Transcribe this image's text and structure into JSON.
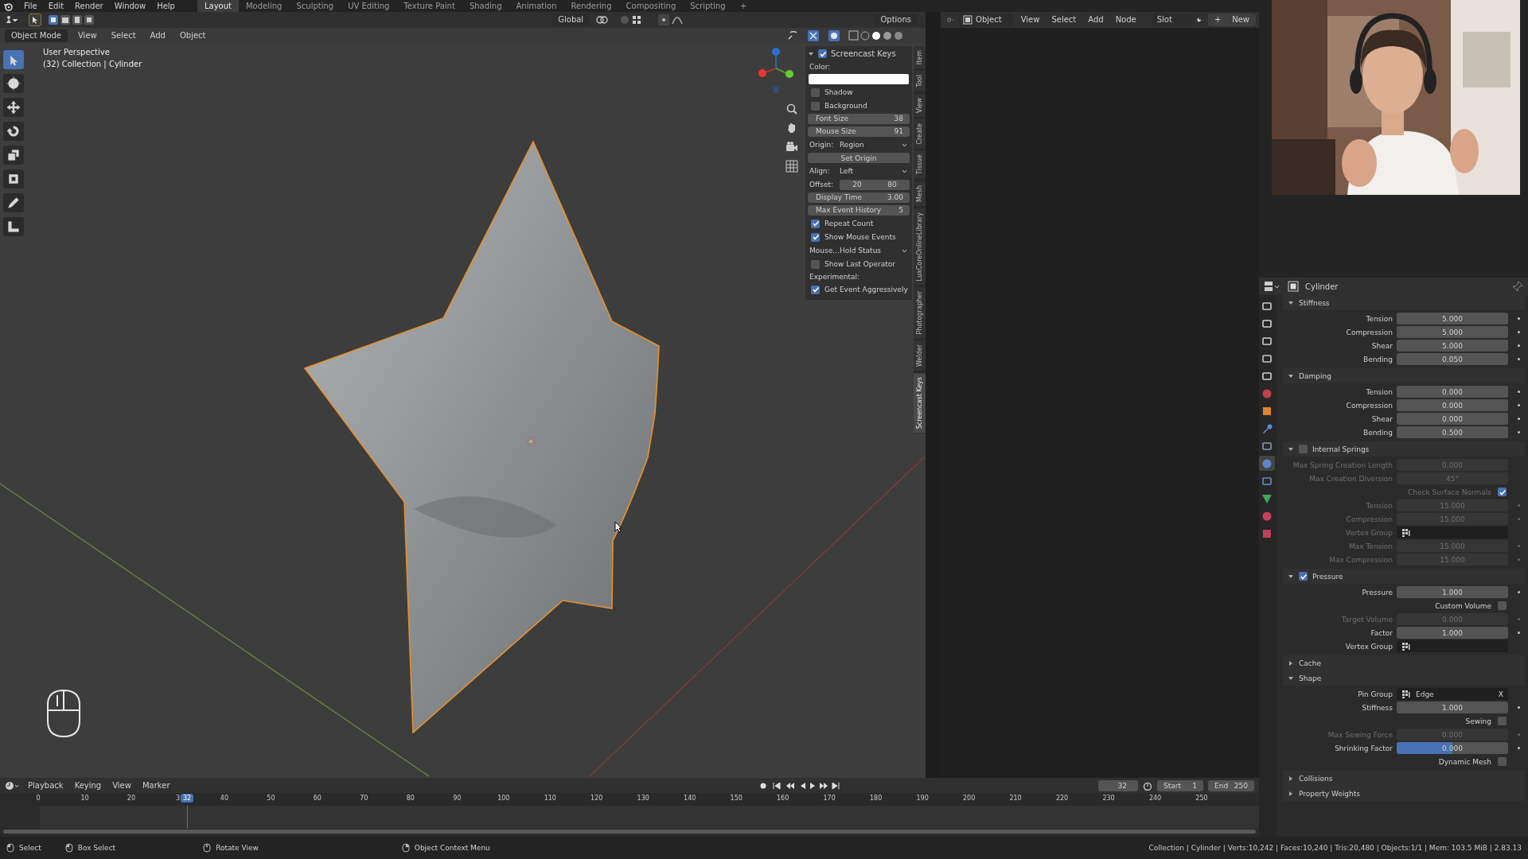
{
  "top_bar": {
    "menus": [
      "File",
      "Edit",
      "Render",
      "Window",
      "Help"
    ],
    "workspaces": [
      {
        "label": "Layout",
        "selected": true
      },
      {
        "label": "Modeling",
        "selected": false
      },
      {
        "label": "Sculpting",
        "selected": false
      },
      {
        "label": "UV Editing",
        "selected": false
      },
      {
        "label": "Texture Paint",
        "selected": false
      },
      {
        "label": "Shading",
        "selected": false
      },
      {
        "label": "Animation",
        "selected": false
      },
      {
        "label": "Rendering",
        "selected": false
      },
      {
        "label": "Compositing",
        "selected": false
      },
      {
        "label": "Scripting",
        "selected": false
      }
    ],
    "add_tab": "+"
  },
  "viewport": {
    "orientation": "Global",
    "options": "Options",
    "mode": "Object Mode",
    "menus": [
      "View",
      "Select",
      "Add",
      "Object"
    ],
    "overlay_lines": [
      "User Perspective",
      "(32) Collection | Cylinder"
    ],
    "tools": [
      {
        "kind": "select",
        "selected": true
      },
      {
        "kind": "cursor",
        "selected": false
      },
      {
        "kind": "move",
        "selected": false
      },
      {
        "kind": "rotate",
        "selected": false
      },
      {
        "kind": "scale",
        "selected": false
      },
      {
        "kind": "transform",
        "selected": false
      },
      {
        "kind": "annotate",
        "selected": false
      },
      {
        "kind": "measure",
        "selected": false
      }
    ],
    "side_tabs": [
      {
        "label": "Item",
        "selected": false
      },
      {
        "label": "Tool",
        "selected": false
      },
      {
        "label": "View",
        "selected": false
      },
      {
        "label": "Create",
        "selected": false
      },
      {
        "label": "Tissue",
        "selected": false
      },
      {
        "label": "Mesh",
        "selected": false
      },
      {
        "label": "LuxCoreOnlineLibrary",
        "selected": false
      },
      {
        "label": "Photographer",
        "selected": false
      },
      {
        "label": "Welder",
        "selected": false
      },
      {
        "label": "Screencast Keys",
        "selected": true
      }
    ],
    "n_panel": {
      "title": "Screencast Keys",
      "enabled": true,
      "items": [
        {
          "kind": "label",
          "label": "Color:"
        },
        {
          "kind": "color",
          "color": "#ffffff"
        },
        {
          "kind": "check",
          "label": "Shadow",
          "checked": false
        },
        {
          "kind": "check",
          "label": "Background",
          "checked": false
        },
        {
          "kind": "number",
          "label": "Font Size",
          "value": "38"
        },
        {
          "kind": "number",
          "label": "Mouse Size",
          "value": "91"
        },
        {
          "kind": "dropdown",
          "label": "Origin:",
          "value": "Region"
        },
        {
          "kind": "button",
          "label": "Set Origin"
        },
        {
          "kind": "dropdown",
          "label": "Align:",
          "value": "Left"
        },
        {
          "kind": "pair",
          "label": "Offset:",
          "values": [
            "20",
            "80"
          ]
        },
        {
          "kind": "number",
          "label": "Display Time",
          "value": "3.00"
        },
        {
          "kind": "number",
          "label": "Max Event History",
          "value": "5"
        },
        {
          "kind": "check",
          "label": "Repeat Count",
          "checked": true
        },
        {
          "kind": "check",
          "label": "Show Mouse Events",
          "checked": true
        },
        {
          "kind": "dropdown",
          "label": "Mouse...",
          "value": "Hold Status"
        },
        {
          "kind": "check",
          "label": "Show Last Operator",
          "checked": false
        },
        {
          "kind": "label",
          "label": "Experimental:"
        },
        {
          "kind": "check",
          "label": "Get Event Aggressively",
          "checked": true
        }
      ]
    }
  },
  "node_editor": {
    "type": "Object",
    "menus": [
      "View",
      "Select",
      "Add",
      "Node"
    ],
    "slot": "Slot",
    "new_button": "New",
    "add_icon": "+"
  },
  "properties": {
    "object": "Cylinder",
    "tabs": [
      {
        "kind": "tool",
        "selected": false
      },
      {
        "kind": "render",
        "selected": false
      },
      {
        "kind": "output",
        "selected": false
      },
      {
        "kind": "view-layer",
        "selected": false
      },
      {
        "kind": "scene",
        "selected": false
      },
      {
        "kind": "world",
        "selected": false
      },
      {
        "kind": "object",
        "selected": false
      },
      {
        "kind": "modifier",
        "selected": false
      },
      {
        "kind": "particles",
        "selected": false
      },
      {
        "kind": "physics",
        "selected": true
      },
      {
        "kind": "constraints",
        "selected": false
      },
      {
        "kind": "data",
        "selected": false
      },
      {
        "kind": "material",
        "selected": false
      },
      {
        "kind": "texture",
        "selected": false
      }
    ],
    "sections": [
      {
        "title": "Stiffness",
        "expanded": true,
        "rows": [
          {
            "kind": "number",
            "label": "Tension",
            "value": "5.000",
            "disabled": false,
            "dot": true
          },
          {
            "kind": "number",
            "label": "Compression",
            "value": "5.000",
            "disabled": false,
            "dot": true
          },
          {
            "kind": "number",
            "label": "Shear",
            "value": "5.000",
            "disabled": false,
            "dot": true
          },
          {
            "kind": "number",
            "label": "Bending",
            "value": "0.050",
            "disabled": false,
            "dot": true
          }
        ]
      },
      {
        "title": "Damping",
        "expanded": true,
        "rows": [
          {
            "kind": "number",
            "label": "Tension",
            "value": "0.000",
            "disabled": false,
            "dot": true
          },
          {
            "kind": "number",
            "label": "Compression",
            "value": "0.000",
            "disabled": false,
            "dot": true
          },
          {
            "kind": "number",
            "label": "Shear",
            "value": "0.000",
            "disabled": false,
            "dot": true
          },
          {
            "kind": "number",
            "label": "Bending",
            "value": "0.500",
            "disabled": false,
            "dot": true
          }
        ]
      },
      {
        "title": "Internal Springs",
        "expanded": true,
        "checked": false,
        "rows": [
          {
            "kind": "number",
            "label": "Max Spring Creation Length",
            "value": "0.000",
            "disabled": true,
            "dot": false
          },
          {
            "kind": "number",
            "label": "Max Creation Diversion",
            "value": "45°",
            "disabled": true,
            "dot": false
          },
          {
            "kind": "check",
            "label": "Check Surface Normals",
            "checked": true,
            "disabled": true
          },
          {
            "kind": "number",
            "label": "Tension",
            "value": "15.000",
            "disabled": true,
            "dot": true
          },
          {
            "kind": "number",
            "label": "Compression",
            "value": "15.000",
            "disabled": true,
            "dot": true
          },
          {
            "kind": "group",
            "label": "Vertex Group",
            "disabled": true
          },
          {
            "kind": "number",
            "label": "Max Tension",
            "value": "15.000",
            "disabled": true,
            "dot": true
          },
          {
            "kind": "number",
            "label": "Max Compression",
            "value": "15.000",
            "disabled": true,
            "dot": true
          }
        ]
      },
      {
        "title": "Pressure",
        "expanded": true,
        "checked": true,
        "rows": [
          {
            "kind": "number",
            "label": "Pressure",
            "value": "1.000",
            "disabled": false,
            "dot": true
          },
          {
            "kind": "check",
            "label": "Custom Volume",
            "checked": false,
            "disabled": false
          },
          {
            "kind": "number",
            "label": "Target Volume",
            "value": "0.000",
            "disabled": true,
            "dot": true
          },
          {
            "kind": "number",
            "label": "Factor",
            "value": "1.000",
            "disabled": false,
            "dot": true
          },
          {
            "kind": "group",
            "label": "Vertex Group",
            "disabled": false
          }
        ]
      },
      {
        "title": "Cache",
        "expanded": false
      },
      {
        "title": "Shape",
        "expanded": true,
        "rows": [
          {
            "kind": "group",
            "label": "Pin Group",
            "value": "Edge",
            "clear": "X",
            "disabled": false
          },
          {
            "kind": "number",
            "label": "Stiffness",
            "value": "1.000",
            "disabled": false,
            "dot": true
          },
          {
            "kind": "check",
            "label": "Sewing",
            "checked": false,
            "disabled": false
          },
          {
            "kind": "number",
            "label": "Max Sewing Force",
            "value": "0.000",
            "disabled": true,
            "dot": true
          },
          {
            "kind": "number",
            "label": "Shrinking Factor",
            "value": "0.000",
            "disabled": false,
            "dot": true,
            "level": 0.5
          },
          {
            "kind": "check",
            "label": "Dynamic Mesh",
            "checked": false,
            "disabled": false
          }
        ]
      },
      {
        "title": "Collisions",
        "expanded": false
      },
      {
        "title": "Property Weights",
        "expanded": false
      }
    ]
  },
  "timeline": {
    "menus": [
      "Playback",
      "Keying",
      "View",
      "Marker"
    ],
    "current_frame": "32",
    "start_label": "Start",
    "start": "1",
    "end_label": "End",
    "end": "250",
    "ticks": [
      "0",
      "10",
      "20",
      "3",
      "40",
      "50",
      "60",
      "70",
      "80",
      "90",
      "100",
      "110",
      "120",
      "130",
      "140",
      "150",
      "160",
      "170",
      "180",
      "190",
      "200",
      "210",
      "220",
      "230",
      "240",
      "250"
    ],
    "playhead": {
      "label": "32",
      "level": 0.128
    }
  },
  "status_bar": {
    "hints": [
      {
        "kind": "left",
        "label": "Select"
      },
      {
        "kind": "box",
        "label": "Box Select"
      },
      {
        "kind": "middle",
        "label": "Rotate View"
      },
      {
        "kind": "right",
        "label": "Object Context Menu"
      }
    ],
    "stats": "Collection | Cylinder | Verts:10,242 | Faces:10,240 | Tris:20,480 | Objects:1/1 | Mem: 103.5 MiB | 2.83.13"
  }
}
